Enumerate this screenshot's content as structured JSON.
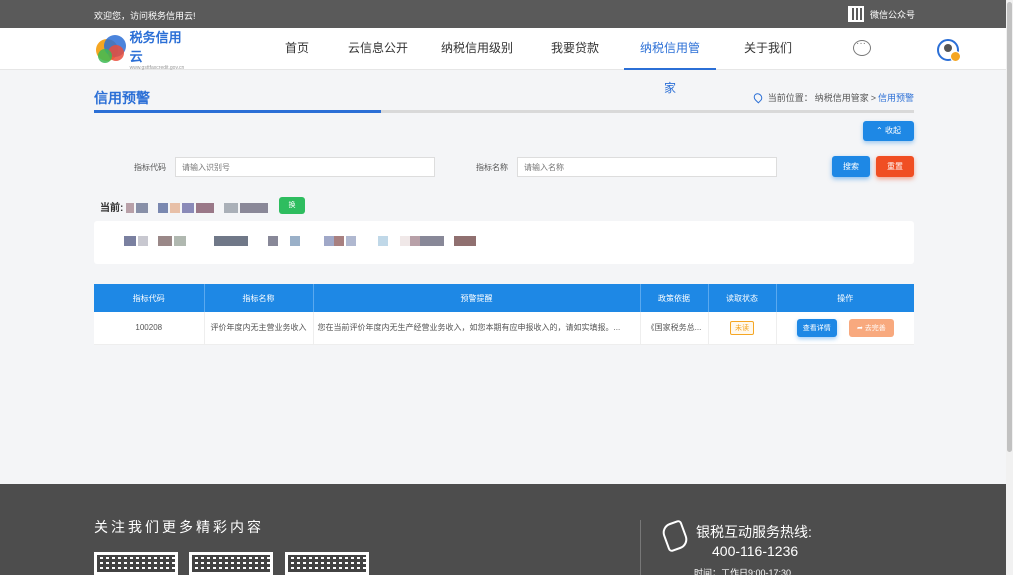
{
  "topbar": {
    "welcome": "欢迎您，访问税务信用云!",
    "wechat": "微信公众号"
  },
  "logo": {
    "name": "税务信用云",
    "sub": "www.gsttfaxcredit.gov.cn"
  },
  "nav": {
    "items": [
      {
        "label": "首页"
      },
      {
        "label": "云信息公开"
      },
      {
        "label": "纳税信用级别"
      },
      {
        "label": "我要贷款"
      },
      {
        "label": "纳税信用管家",
        "active": true
      },
      {
        "label": "关于我们"
      }
    ]
  },
  "page": {
    "title": "信用预警",
    "breadcrumb_prefix": "当前位置：",
    "breadcrumb_parent": "纳税信用管家",
    "breadcrumb_sep": " > ",
    "breadcrumb_current": "信用预警",
    "progress": 0.35
  },
  "actions": {
    "collapse": "⌃ 收起",
    "search": "搜索",
    "reset": "重置",
    "switch": "换"
  },
  "filters": {
    "code_label": "指标代码",
    "code_placeholder": "请输入识别号",
    "name_label": "指标名称",
    "name_placeholder": "请输入名称"
  },
  "current_label": "当前:",
  "table": {
    "headers": [
      "指标代码",
      "指标名称",
      "预警提醒",
      "政策依据",
      "读取状态",
      "操作"
    ],
    "rows": [
      {
        "code": "100208",
        "name": "评价年度内无主营业务收入",
        "warning": "您在当前评价年度内无生产经营业务收入，如您本期有应申报收入的，请如实填报。...",
        "policy": "《国家税务总...",
        "status": "未读",
        "detail": "查看详情",
        "handle": "去完善"
      }
    ]
  },
  "footer": {
    "follow": "关注我们更多精彩内容",
    "hotline_label": "银税互动服务热线:",
    "hotline_number": "400-116-1236",
    "hours": "时间：工作日9:00-17:30"
  },
  "colors": {
    "primary": "#1e88e5",
    "danger": "#f04e23",
    "success": "#2ebd5f"
  }
}
